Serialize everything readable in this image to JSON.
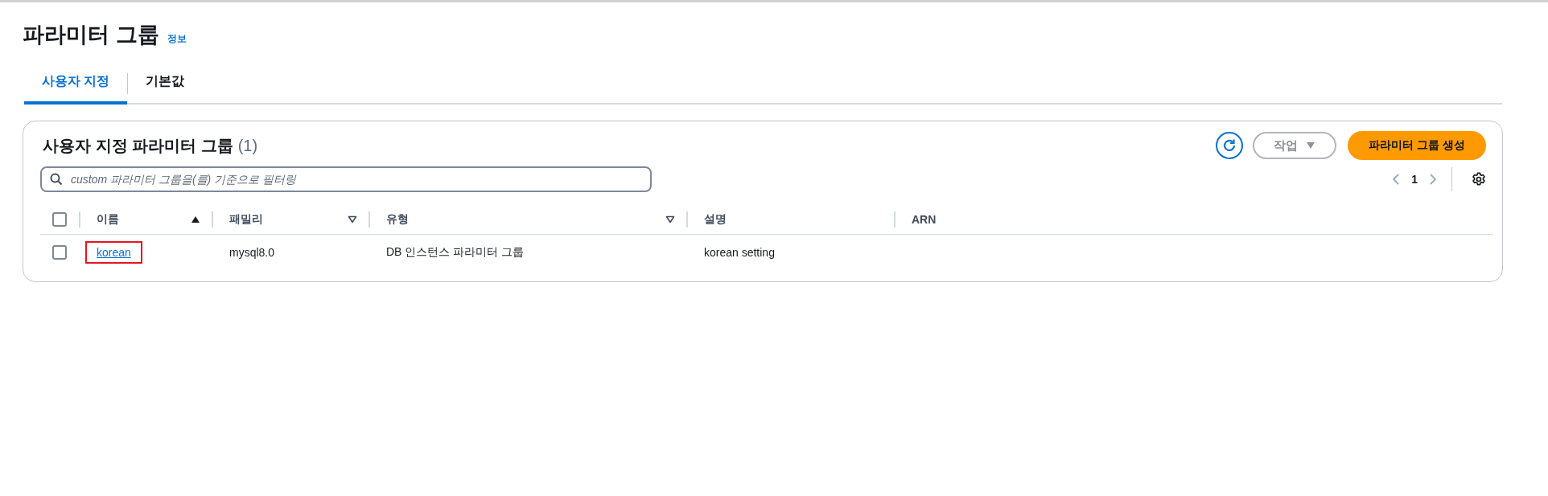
{
  "page": {
    "title": "파라미터 그룹",
    "info_link": "정보"
  },
  "tabs": [
    {
      "label": "사용자 지정",
      "selected": true
    },
    {
      "label": "기본값",
      "selected": false
    }
  ],
  "panel": {
    "title": "사용자 지정 파라미터 그룹",
    "count": "(1)",
    "actions_button": "작업",
    "create_button": "파라미터 그룹 생성",
    "search": {
      "placeholder": "custom 파라미터 그룹을(를) 기준으로 필터링"
    },
    "pagination": {
      "page": "1"
    }
  },
  "table": {
    "all_checked": false,
    "columns": [
      {
        "label": "이름",
        "sortable": true,
        "sorted": true
      },
      {
        "label": "패밀리",
        "sortable": true,
        "sorted": false
      },
      {
        "label": "유형",
        "sortable": true,
        "sorted": false
      },
      {
        "label": "설명",
        "sortable": false,
        "sorted": false
      },
      {
        "label": "ARN",
        "sortable": false,
        "sorted": false
      }
    ],
    "rows": [
      {
        "selected": false,
        "name": "korean",
        "highlighted": true,
        "family": "mysql8.0",
        "type": "DB 인스턴스 파라미터 그룹",
        "description": "korean setting"
      }
    ]
  }
}
